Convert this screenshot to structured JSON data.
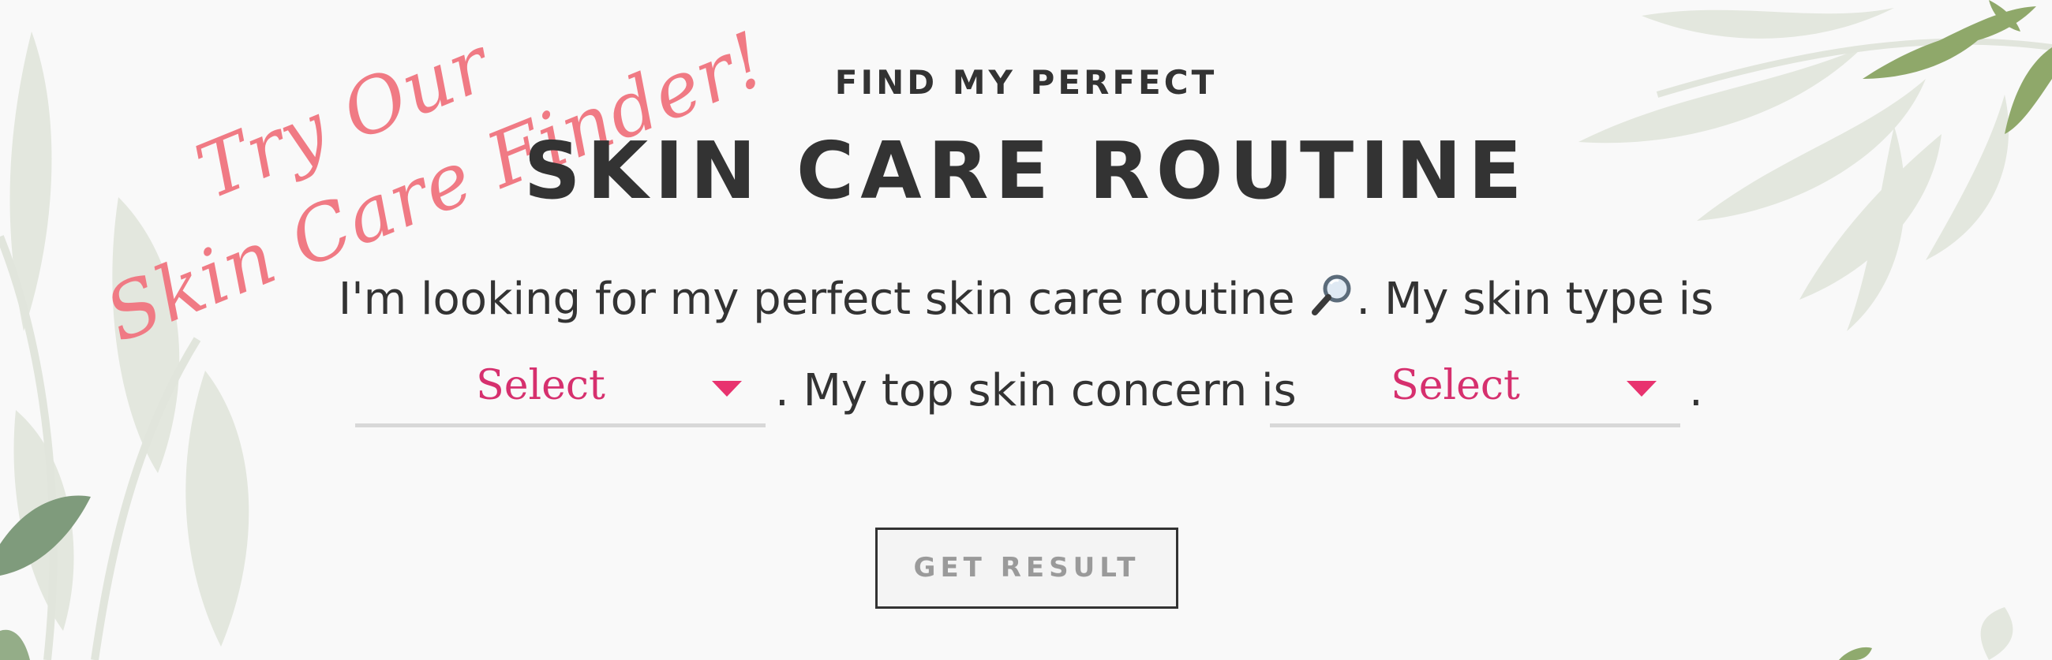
{
  "promo": {
    "line1": "Try Our",
    "line2": "Skin Care Finder!"
  },
  "header": {
    "kicker": "FIND MY PERFECT",
    "title": "SKIN CARE ROUTINE"
  },
  "form": {
    "sentence_start": "I'm looking for my perfect skin care routine",
    "sentence_icon": "magnifying-glass-icon",
    "sentence_mid": ". My skin type is",
    "skin_type_select": {
      "value": "Select"
    },
    "concern_text": ". My top skin concern is",
    "concern_select": {
      "value": "Select"
    },
    "end_period": "."
  },
  "button": {
    "label": "GET RESULT"
  },
  "colors": {
    "background": "#f9f9f9",
    "text": "#333333",
    "accent_pink": "#e8336f",
    "promo_pink": "#f07a84",
    "leaf_light": "#dfe5d8",
    "leaf_green": "#8faa6e"
  }
}
